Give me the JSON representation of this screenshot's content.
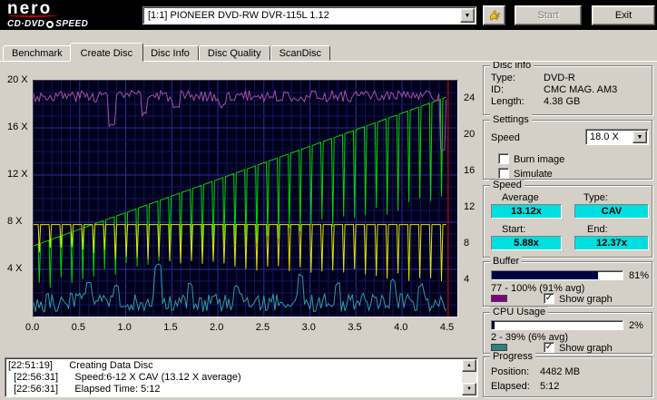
{
  "header": {
    "brand": {
      "name": "nero",
      "sub1": "CD·DVD",
      "sub2": "SPEED"
    },
    "drive_select": {
      "value": "[1:1]   PIONEER DVD-RW  DVR-115L 1.12"
    },
    "start_label": "Start",
    "exit_label": "Exit"
  },
  "tabs": [
    {
      "label": "Benchmark"
    },
    {
      "label": "Create Disc"
    },
    {
      "label": "Disc Info"
    },
    {
      "label": "Disc Quality"
    },
    {
      "label": "ScanDisc"
    }
  ],
  "active_tab": "Create Disc",
  "chart": {
    "axis_left": [
      {
        "t": "20 X",
        "v": 20
      },
      {
        "t": "16 X",
        "v": 16
      },
      {
        "t": "12 X",
        "v": 12
      },
      {
        "t": "8 X",
        "v": 8
      },
      {
        "t": "4 X",
        "v": 4
      }
    ],
    "axis_right": [
      {
        "t": "24",
        "v": 24
      },
      {
        "t": "20",
        "v": 20
      },
      {
        "t": "16",
        "v": 16
      },
      {
        "t": "12",
        "v": 12
      },
      {
        "t": "8",
        "v": 8
      },
      {
        "t": "4",
        "v": 4
      }
    ],
    "axis_bottom": [
      {
        "t": "0.0",
        "v": 0
      },
      {
        "t": "0.5",
        "v": 0.5
      },
      {
        "t": "1.0",
        "v": 1
      },
      {
        "t": "1.5",
        "v": 1.5
      },
      {
        "t": "2.0",
        "v": 2
      },
      {
        "t": "2.5",
        "v": 2.5
      },
      {
        "t": "3.0",
        "v": 3
      },
      {
        "t": "3.5",
        "v": 3.5
      },
      {
        "t": "4.0",
        "v": 4
      },
      {
        "t": "4.5",
        "v": 4.5
      }
    ]
  },
  "chart_data": {
    "type": "line",
    "x_unit": "GB",
    "x_range": [
      0,
      4.6
    ],
    "y_left_range": [
      0,
      20
    ],
    "y_right_range": [
      0,
      26
    ],
    "grid": {
      "minor": "#14145e",
      "major": "#2b2b9e",
      "bg": "#00001c"
    },
    "series": [
      {
        "name": "write-speed",
        "color": "#00d800",
        "gen": {
          "kind": "ramp",
          "x0": 0,
          "x1": 4.48,
          "y0": 6.0,
          "y1": 18.6,
          "period": 0.118,
          "depth0": 3.0,
          "depth1": 8.0,
          "jitter": 1.0,
          "seed": 9
        }
      },
      {
        "name": "rotation-speed",
        "color": "#e2e200",
        "gen": {
          "kind": "flat",
          "x0": 0,
          "x1": 4.48,
          "y": 7.8,
          "period": 0.118,
          "depth0": 1.6,
          "depth1": 4.4,
          "jitter": 0.8,
          "seed": 4
        }
      },
      {
        "name": "buffer-level",
        "color": "#a74fa7",
        "gen": {
          "kind": "noisy",
          "x0": 0,
          "x1": 4.48,
          "base": 18.7,
          "amp": 0.5,
          "step": 0.02,
          "seed": 3,
          "max": 19.4,
          "marks": [
            [
              0.85,
              16.3
            ],
            [
              1.2,
              17.2
            ],
            [
              1.55,
              17.6
            ],
            [
              2.05,
              17.9
            ],
            [
              4.44,
              14.0
            ]
          ]
        }
      },
      {
        "name": "cpu-usage",
        "color": "#2f9e9e",
        "gen": {
          "kind": "noisy",
          "x0": 0,
          "x1": 4.48,
          "base": 1.2,
          "amp": 0.8,
          "step": 0.02,
          "seed": 6,
          "min": 0.15,
          "marks": [
            [
              0.6,
              3.0
            ],
            [
              0.9,
              2.6
            ],
            [
              1.35,
              4.3
            ],
            [
              1.7,
              2.8
            ],
            [
              2.2,
              2.6
            ],
            [
              2.9,
              3.4
            ],
            [
              3.3,
              2.7
            ],
            [
              3.9,
              3.0
            ],
            [
              4.2,
              2.6
            ]
          ]
        }
      }
    ],
    "cursor_x": 4.5,
    "cursor_color": "#e00000"
  },
  "disc_info": {
    "title": "Disc info",
    "rows": [
      {
        "label": "Type:",
        "value": "DVD-R"
      },
      {
        "label": "ID:",
        "value": "CMC MAG. AM3"
      },
      {
        "label": "Length:",
        "value": "4.38 GB"
      }
    ]
  },
  "settings": {
    "title": "Settings",
    "speed_label": "Speed",
    "speed_value": "18.0 X",
    "burn_image_label": "Burn image",
    "simulate_label": "Simulate",
    "burn_image_checked": false,
    "simulate_checked": false
  },
  "speed": {
    "title": "Speed",
    "average_label": "Average",
    "type_label": "Type:",
    "average": "13.12x",
    "type": "CAV",
    "start_label": "Start:",
    "end_label": "End:",
    "start": "5.88x",
    "end": "12.37x"
  },
  "buffer": {
    "title": "Buffer",
    "value": 81,
    "percent": "81%",
    "range": "77 - 100% (91% avg)",
    "swatch": "#800080",
    "show_graph_label": "Show graph",
    "show_graph_checked": true
  },
  "cpu": {
    "title": "CPU Usage",
    "value": 2,
    "percent": "2%",
    "range": "2 - 39% (6% avg)",
    "swatch": "#2f8080",
    "show_graph_label": "Show graph",
    "show_graph_checked": true
  },
  "progress": {
    "title": "Progress",
    "position_label": "Position:",
    "position": "4482 MB",
    "elapsed_label": "Elapsed:",
    "elapsed": "5:12"
  },
  "log": {
    "lines": [
      "[22:51:19]      Creating Data Disc",
      "  [22:56:31]      Speed:6-12 X CAV (13.12 X average)",
      "  [22:56:31]      Elapsed Time: 5:12"
    ]
  }
}
